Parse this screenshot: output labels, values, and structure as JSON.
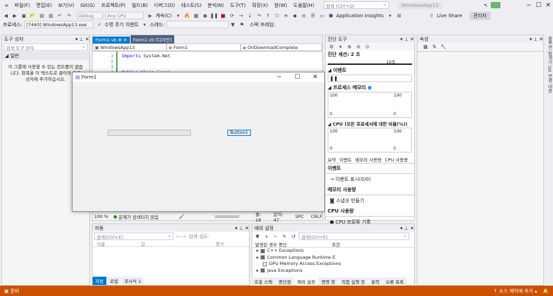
{
  "menu": {
    "items": [
      "파일(F)",
      "편집(E)",
      "보기(V)",
      "Git(G)",
      "프로젝트(P)",
      "빌드(B)",
      "디버그(D)",
      "테스트(S)",
      "분석(N)",
      "도구(T)",
      "확장(X)",
      "창(W)",
      "도움말(H)"
    ],
    "search_placeholder": "검색 (Ctrl+Q)",
    "window_title": "WindowsApp13",
    "admin_label": "관리자"
  },
  "toolbar": {
    "debug_combo": "Debug",
    "cpu_combo": "Any CPU",
    "continue_label": "계속(C)",
    "app_insights_label": "Application Insights",
    "live_share_label": "Live Share"
  },
  "toolbar2": {
    "process_label": "프로세스:",
    "process_value": "[7440] WindowsApp13.exe",
    "lifecycle_label": "수명 주기 이벤트",
    "thread_label": "스레드:",
    "stack_label": "스택 프레임:"
  },
  "toolbox": {
    "title": "도구 상자",
    "search_placeholder": "검색 도구 상자",
    "group": "일반",
    "empty_message": "이 그룹에 사용할 수 있는 컨트롤이 없습니다. 항목을 이 텍스트로 끌어와 도구 상자에 추가하십시오."
  },
  "editor": {
    "tabs": [
      "Form1.vb",
      "Form1.vb [디자인]"
    ],
    "nav": [
      "WindowsApp13",
      "Form1",
      "OnDownloadComplete"
    ],
    "line_numbers": [
      "1",
      "2",
      "3",
      "4"
    ],
    "line1_kw": "Imports",
    "line1_text": " System.Net",
    "line4_kw": "Public Class",
    "line4_text": " Form1",
    "zoom": "100 %",
    "no_issues": "문제가 검색되지 않음",
    "line": "줄: 18",
    "col": "문자: 47",
    "spc": "SPC",
    "crlf": "CRLF"
  },
  "form_window": {
    "title": "Form1",
    "button_label": "Button1",
    "progress": 0
  },
  "diagnostics": {
    "title": "진단 도구",
    "session_label": "진단 세션: 2 초",
    "timeline_label": "10초",
    "events_label": "이벤트",
    "memory_label": "프로세스 메모리",
    "memory_max": "100",
    "memory_min": "0",
    "cpu_label": "CPU (모든 프로세서에 대한 비율(%))",
    "cpu_max": "100",
    "cpu_min": "0",
    "tabs": [
      "요약",
      "이벤트",
      "메모리 사용량",
      "CPU 사용량"
    ],
    "sec_events": "이벤트",
    "events_count": "이벤트 표시(0/0)",
    "sec_memory": "메모리 사용량",
    "snapshot": "스냅샷 만들기",
    "sec_cpu": "CPU 사용량",
    "record_cpu": "CPU 프로필 기록"
  },
  "properties": {
    "title": "속성",
    "side_tabs": "솔루션 탐색기   Git 변경 내용"
  },
  "autos": {
    "title": "자동",
    "search_placeholder": "검색(Ctrl+E)",
    "search_depth": "검색 심도:",
    "columns": [
      "이름",
      "값",
      "형식"
    ],
    "tabs": [
      "자동",
      "로컬",
      "조사식 1"
    ]
  },
  "exceptions": {
    "title": "예외 설정",
    "search_placeholder": "검색(Ctrl+E)",
    "columns": [
      "발생된 경우 중단",
      "조건"
    ],
    "items": [
      "C++ Exceptions",
      "Common Language Runtime Exceptions",
      "GPU Memory Access Exceptions",
      "Java Exceptions"
    ],
    "tabs": [
      "호출 스택",
      "중단점",
      "예외 설정",
      "명령 창",
      "직접 실행 창",
      "출력",
      "오류 목록"
    ]
  },
  "status": {
    "ready": "준비",
    "source_control": "소스 제어에 추가"
  },
  "colors": {
    "accent": "#007acc",
    "status": "#ca5100"
  }
}
